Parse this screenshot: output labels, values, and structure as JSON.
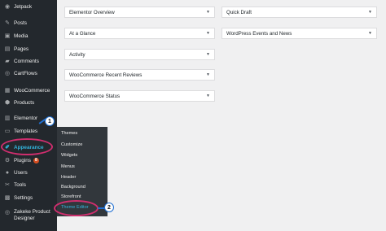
{
  "sidebar": {
    "items": [
      {
        "label": "Jetpack",
        "icon": "jetpack-icon",
        "glyph": "◉"
      },
      {
        "label": "Posts",
        "icon": "pin-icon",
        "glyph": "✎"
      },
      {
        "label": "Media",
        "icon": "media-icon",
        "glyph": "▣"
      },
      {
        "label": "Pages",
        "icon": "pages-icon",
        "glyph": "▤"
      },
      {
        "label": "Comments",
        "icon": "comments-icon",
        "glyph": "▰"
      },
      {
        "label": "CartFlows",
        "icon": "cartflows-icon",
        "glyph": "◎"
      },
      {
        "label": "WooCommerce",
        "icon": "woocommerce-icon",
        "glyph": "▦"
      },
      {
        "label": "Products",
        "icon": "products-icon",
        "glyph": "⬢"
      },
      {
        "label": "Elementor",
        "icon": "elementor-icon",
        "glyph": "▥"
      },
      {
        "label": "Templates",
        "icon": "templates-icon",
        "glyph": "▭"
      },
      {
        "label": "Appearance",
        "icon": "paintbrush-icon",
        "glyph": "✐"
      },
      {
        "label": "Plugins",
        "icon": "plugins-icon",
        "glyph": "⚙",
        "badge": "8"
      },
      {
        "label": "Users",
        "icon": "users-icon",
        "glyph": "●"
      },
      {
        "label": "Tools",
        "icon": "tools-icon",
        "glyph": "✂"
      },
      {
        "label": "Settings",
        "icon": "settings-icon",
        "glyph": "▩"
      },
      {
        "label": "Zakeke Product Designer",
        "line1": "Zakeke Product",
        "line2": "Designer",
        "icon": "zakeke-icon",
        "glyph": "◎"
      }
    ]
  },
  "appearance_submenu": {
    "items": [
      "Themes",
      "Customize",
      "Widgets",
      "Menus",
      "Header",
      "Background",
      "Storefront",
      "Theme Editor"
    ]
  },
  "callouts": {
    "step1": "1",
    "step2": "2"
  },
  "dashboard": {
    "left_widgets": [
      "Elementor Overview",
      "At a Glance",
      "Activity",
      "WooCommerce Recent Reviews",
      "WooCommerce Status"
    ],
    "right_widgets": [
      "Quick Draft",
      "WordPress Events and News"
    ]
  },
  "colors": {
    "sidebar_bg": "#23282d",
    "flyout_bg": "#32373c",
    "active_blue": "#33b3db",
    "highlight_ring": "#cf2e6e",
    "callout_border": "#1f6fd1"
  }
}
